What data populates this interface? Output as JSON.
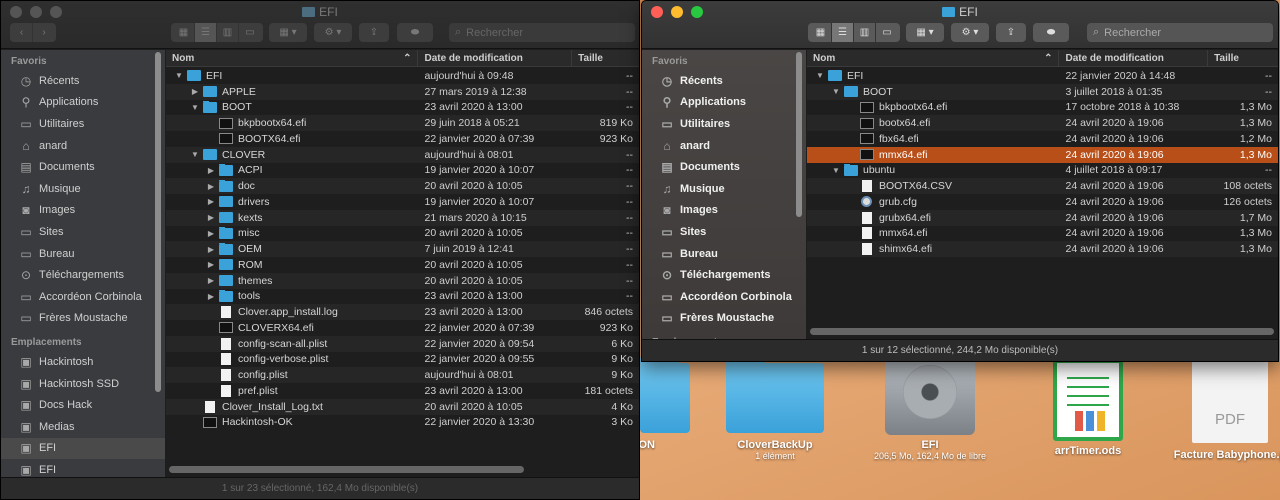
{
  "desktop": {
    "items": [
      {
        "label": "ON",
        "sub": ""
      },
      {
        "label": "CloverBackUp",
        "sub": "1 élément"
      },
      {
        "label": "EFI",
        "sub": "206,5 Mo, 162,4 Mo de libre"
      },
      {
        "label": "arrTimer.ods",
        "sub": ""
      },
      {
        "label": "Facture Babyphone.p",
        "sub": "",
        "icon_text": "PDF"
      }
    ]
  },
  "left": {
    "title": "EFI",
    "search_placeholder": "Rechercher",
    "sidebar": {
      "favoris_header": "Favoris",
      "favoris": [
        {
          "label": "Récents",
          "icon": "clock-icon"
        },
        {
          "label": "Applications",
          "icon": "applications-icon"
        },
        {
          "label": "Utilitaires",
          "icon": "folder-icon"
        },
        {
          "label": "anard",
          "icon": "home-icon"
        },
        {
          "label": "Documents",
          "icon": "document-icon"
        },
        {
          "label": "Musique",
          "icon": "music-icon"
        },
        {
          "label": "Images",
          "icon": "camera-icon"
        },
        {
          "label": "Sites",
          "icon": "folder-icon"
        },
        {
          "label": "Bureau",
          "icon": "folder-icon"
        },
        {
          "label": "Téléchargements",
          "icon": "download-icon"
        },
        {
          "label": "Accordéon Corbinola",
          "icon": "folder-icon"
        },
        {
          "label": "Frères Moustache",
          "icon": "folder-icon"
        }
      ],
      "emplacements_header": "Emplacements",
      "emplacements": [
        {
          "label": "Hackintosh",
          "icon": "disk-icon"
        },
        {
          "label": "Hackintosh SSD",
          "icon": "disk-icon"
        },
        {
          "label": "Docs Hack",
          "icon": "disk-icon"
        },
        {
          "label": "Medias",
          "icon": "disk-icon"
        },
        {
          "label": "EFI",
          "icon": "disk-icon",
          "selected": true
        },
        {
          "label": "EFI",
          "icon": "disk-icon"
        }
      ]
    },
    "columns": {
      "name": "Nom",
      "date": "Date de modification",
      "size": "Taille"
    },
    "rows": [
      {
        "name": "EFI",
        "date": "aujourd'hui à 09:48",
        "size": "--",
        "depth": 0,
        "type": "folder",
        "toggle": "open"
      },
      {
        "name": "APPLE",
        "date": "27 mars 2019 à 12:38",
        "size": "--",
        "depth": 1,
        "type": "folder",
        "toggle": "closed"
      },
      {
        "name": "BOOT",
        "date": "23 avril 2020 à 13:00",
        "size": "--",
        "depth": 1,
        "type": "folder",
        "toggle": "open"
      },
      {
        "name": "bkpbootx64.efi",
        "date": "29 juin 2018 à 05:21",
        "size": "819 Ko",
        "depth": 2,
        "type": "exec",
        "toggle": ""
      },
      {
        "name": "BOOTX64.efi",
        "date": "22 janvier 2020 à 07:39",
        "size": "923 Ko",
        "depth": 2,
        "type": "exec",
        "toggle": ""
      },
      {
        "name": "CLOVER",
        "date": "aujourd'hui à 08:01",
        "size": "--",
        "depth": 1,
        "type": "folder",
        "toggle": "open"
      },
      {
        "name": "ACPI",
        "date": "19 janvier 2020 à 10:07",
        "size": "--",
        "depth": 2,
        "type": "folder",
        "toggle": "closed"
      },
      {
        "name": "doc",
        "date": "20 avril 2020 à 10:05",
        "size": "--",
        "depth": 2,
        "type": "folder",
        "toggle": "closed"
      },
      {
        "name": "drivers",
        "date": "19 janvier 2020 à 10:07",
        "size": "--",
        "depth": 2,
        "type": "folder",
        "toggle": "closed"
      },
      {
        "name": "kexts",
        "date": "21 mars 2020 à 10:15",
        "size": "--",
        "depth": 2,
        "type": "folder",
        "toggle": "closed"
      },
      {
        "name": "misc",
        "date": "20 avril 2020 à 10:05",
        "size": "--",
        "depth": 2,
        "type": "folder",
        "toggle": "closed"
      },
      {
        "name": "OEM",
        "date": "7 juin 2019 à 12:41",
        "size": "--",
        "depth": 2,
        "type": "folder",
        "toggle": "closed"
      },
      {
        "name": "ROM",
        "date": "20 avril 2020 à 10:05",
        "size": "--",
        "depth": 2,
        "type": "folder",
        "toggle": "closed"
      },
      {
        "name": "themes",
        "date": "20 avril 2020 à 10:05",
        "size": "--",
        "depth": 2,
        "type": "folder",
        "toggle": "closed"
      },
      {
        "name": "tools",
        "date": "23 avril 2020 à 13:00",
        "size": "--",
        "depth": 2,
        "type": "folder",
        "toggle": "closed"
      },
      {
        "name": "Clover.app_install.log",
        "date": "23 avril 2020 à 13:00",
        "size": "846 octets",
        "depth": 2,
        "type": "doc",
        "toggle": ""
      },
      {
        "name": "CLOVERX64.efi",
        "date": "22 janvier 2020 à 07:39",
        "size": "923 Ko",
        "depth": 2,
        "type": "exec",
        "toggle": ""
      },
      {
        "name": "config-scan-all.plist",
        "date": "22 janvier 2020 à 09:54",
        "size": "6 Ko",
        "depth": 2,
        "type": "doc",
        "toggle": ""
      },
      {
        "name": "config-verbose.plist",
        "date": "22 janvier 2020 à 09:55",
        "size": "9 Ko",
        "depth": 2,
        "type": "doc",
        "toggle": ""
      },
      {
        "name": "config.plist",
        "date": "aujourd'hui à 08:01",
        "size": "9 Ko",
        "depth": 2,
        "type": "doc",
        "toggle": ""
      },
      {
        "name": "pref.plist",
        "date": "23 avril 2020 à 13:00",
        "size": "181 octets",
        "depth": 2,
        "type": "doc",
        "toggle": ""
      },
      {
        "name": "Clover_Install_Log.txt",
        "date": "20 avril 2020 à 10:05",
        "size": "4 Ko",
        "depth": 1,
        "type": "doc",
        "toggle": ""
      },
      {
        "name": "Hackintosh-OK",
        "date": "22 janvier 2020 à 13:30",
        "size": "3 Ko",
        "depth": 1,
        "type": "exec",
        "toggle": ""
      }
    ],
    "status": "1 sur 23 sélectionné, 162,4 Mo disponible(s)"
  },
  "right": {
    "title": "EFI",
    "search_placeholder": "Rechercher",
    "sidebar": {
      "favoris_header": "Favoris",
      "favoris": [
        {
          "label": "Récents",
          "icon": "clock-icon"
        },
        {
          "label": "Applications",
          "icon": "applications-icon"
        },
        {
          "label": "Utilitaires",
          "icon": "folder-icon"
        },
        {
          "label": "anard",
          "icon": "home-icon"
        },
        {
          "label": "Documents",
          "icon": "document-icon"
        },
        {
          "label": "Musique",
          "icon": "music-icon"
        },
        {
          "label": "Images",
          "icon": "camera-icon"
        },
        {
          "label": "Sites",
          "icon": "folder-icon"
        },
        {
          "label": "Bureau",
          "icon": "folder-icon"
        },
        {
          "label": "Téléchargements",
          "icon": "download-icon"
        },
        {
          "label": "Accordéon Corbinola",
          "icon": "folder-icon"
        },
        {
          "label": "Frères Moustache",
          "icon": "folder-icon"
        }
      ],
      "emplacements_header": "Emplacements"
    },
    "columns": {
      "name": "Nom",
      "date": "Date de modification",
      "size": "Taille"
    },
    "rows": [
      {
        "name": "EFI",
        "date": "22 janvier 2020 à 14:48",
        "size": "--",
        "depth": 0,
        "type": "folder",
        "toggle": "open"
      },
      {
        "name": "BOOT",
        "date": "3 juillet 2018 à 01:35",
        "size": "--",
        "depth": 1,
        "type": "folder",
        "toggle": "open"
      },
      {
        "name": "bkpbootx64.efi",
        "date": "17 octobre 2018 à 10:38",
        "size": "1,3 Mo",
        "depth": 2,
        "type": "exec",
        "toggle": ""
      },
      {
        "name": "bootx64.efi",
        "date": "24 avril 2020 à 19:06",
        "size": "1,3 Mo",
        "depth": 2,
        "type": "exec",
        "toggle": ""
      },
      {
        "name": "fbx64.efi",
        "date": "24 avril 2020 à 19:06",
        "size": "1,2 Mo",
        "depth": 2,
        "type": "exec",
        "toggle": ""
      },
      {
        "name": "mmx64.efi",
        "date": "24 avril 2020 à 19:06",
        "size": "1,3 Mo",
        "depth": 2,
        "type": "exec",
        "toggle": "",
        "selected": true
      },
      {
        "name": "ubuntu",
        "date": "4 juillet 2018 à 09:17",
        "size": "--",
        "depth": 1,
        "type": "folder",
        "toggle": "open"
      },
      {
        "name": "BOOTX64.CSV",
        "date": "24 avril 2020 à 19:06",
        "size": "108 octets",
        "depth": 2,
        "type": "doc",
        "toggle": ""
      },
      {
        "name": "grub.cfg",
        "date": "24 avril 2020 à 19:06",
        "size": "126 octets",
        "depth": 2,
        "type": "cfg",
        "toggle": ""
      },
      {
        "name": "grubx64.efi",
        "date": "24 avril 2020 à 19:06",
        "size": "1,7 Mo",
        "depth": 2,
        "type": "doc",
        "toggle": ""
      },
      {
        "name": "mmx64.efi",
        "date": "24 avril 2020 à 19:06",
        "size": "1,3 Mo",
        "depth": 2,
        "type": "doc",
        "toggle": ""
      },
      {
        "name": "shimx64.efi",
        "date": "24 avril 2020 à 19:06",
        "size": "1,3 Mo",
        "depth": 2,
        "type": "doc",
        "toggle": ""
      }
    ],
    "status": "1 sur 12 sélectionné, 244,2 Mo disponible(s)"
  },
  "colors": {
    "selection": "#b94f18",
    "folder": "#3aa1d9"
  }
}
